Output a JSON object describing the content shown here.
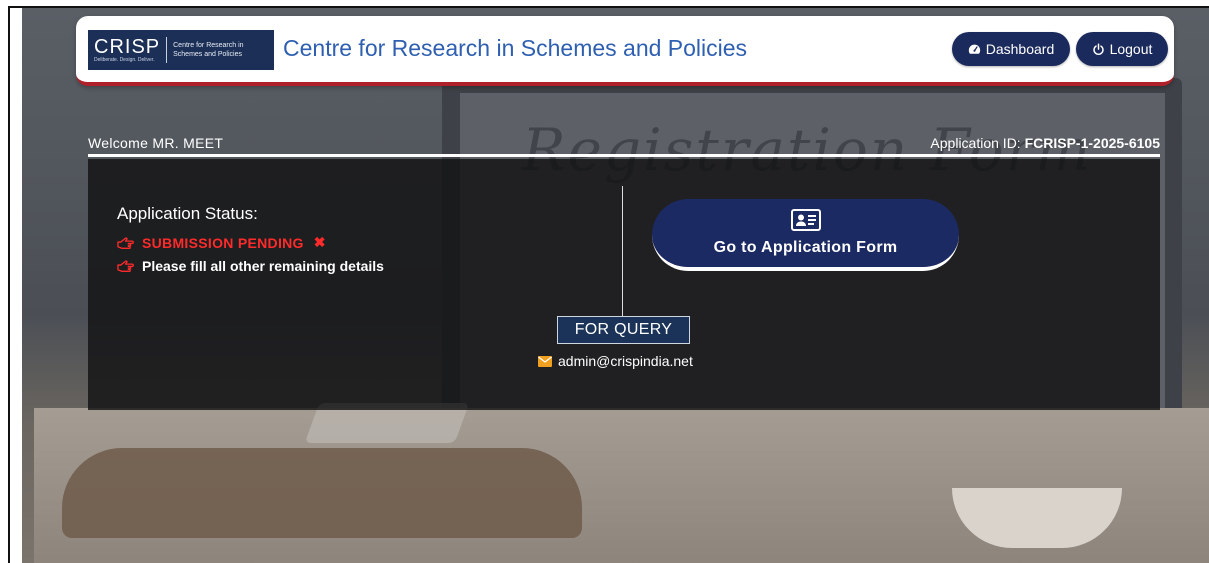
{
  "header": {
    "logo": {
      "wordmark": "CRISP",
      "tagline": "Deliberate. Design. Deliver.",
      "subtitle_line1": "Centre for Research in",
      "subtitle_line2": "Schemes and Policies"
    },
    "title": "Centre for Research in Schemes and Policies",
    "dashboard_label": "Dashboard",
    "logout_label": "Logout",
    "accent_color": "#b0202a",
    "button_color": "#1b2a5c"
  },
  "welcome": {
    "text": "Welcome MR. MEET",
    "app_id_label": "Application ID:",
    "app_id_value": "FCRISP-1-2025-6105"
  },
  "status": {
    "title": "Application Status:",
    "pending": "SUBMISSION PENDING",
    "message": "Please fill all other remaining details",
    "pending_color": "#ff2a2a"
  },
  "actions": {
    "goto_form_label": "Go to Application Form"
  },
  "query": {
    "label": "FOR QUERY",
    "email": "admin@crispindia.net"
  },
  "background": {
    "decor_text": "Registration Form"
  },
  "icons": {
    "dashboard": "tachometer-icon",
    "logout": "power-icon",
    "pointer": "hand-pointer-icon",
    "close": "x-icon",
    "form": "id-card-icon",
    "mail": "envelope-icon"
  }
}
